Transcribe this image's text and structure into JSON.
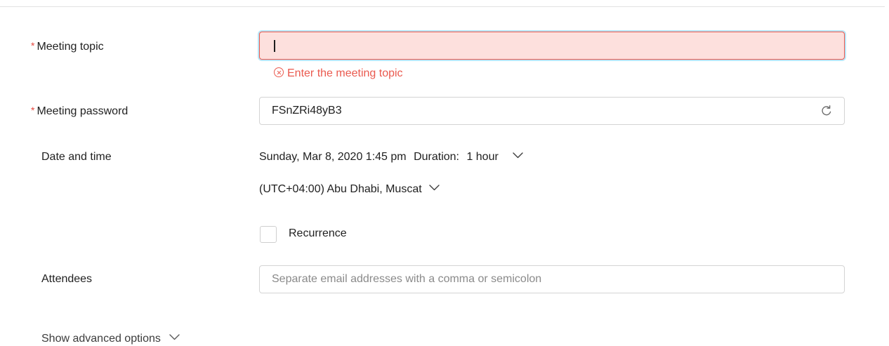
{
  "form": {
    "meeting_topic": {
      "required_mark": "*",
      "label": "Meeting topic",
      "value": "",
      "error_message": "Enter the meeting topic"
    },
    "meeting_password": {
      "required_mark": "*",
      "label": "Meeting password",
      "value": "FSnZRi48yB3",
      "refresh_icon": "refresh-icon"
    },
    "date_time": {
      "label": "Date and time",
      "date": "Sunday, Mar 8, 2020 1:45 pm",
      "duration_label": "Duration:",
      "duration_value": "1 hour",
      "timezone": "(UTC+04:00) Abu Dhabi, Muscat"
    },
    "recurrence": {
      "label": "Recurrence",
      "checked": false
    },
    "attendees": {
      "label": "Attendees",
      "placeholder": "Separate email addresses with a comma or semicolon",
      "value": ""
    },
    "advanced": {
      "label": "Show advanced options"
    }
  },
  "colors": {
    "error": "#ea5a4f",
    "error_bg": "#fde0dd",
    "focus_ring": "#b9e6f7",
    "border": "#d4d4d4",
    "text": "#1f1f1f"
  }
}
